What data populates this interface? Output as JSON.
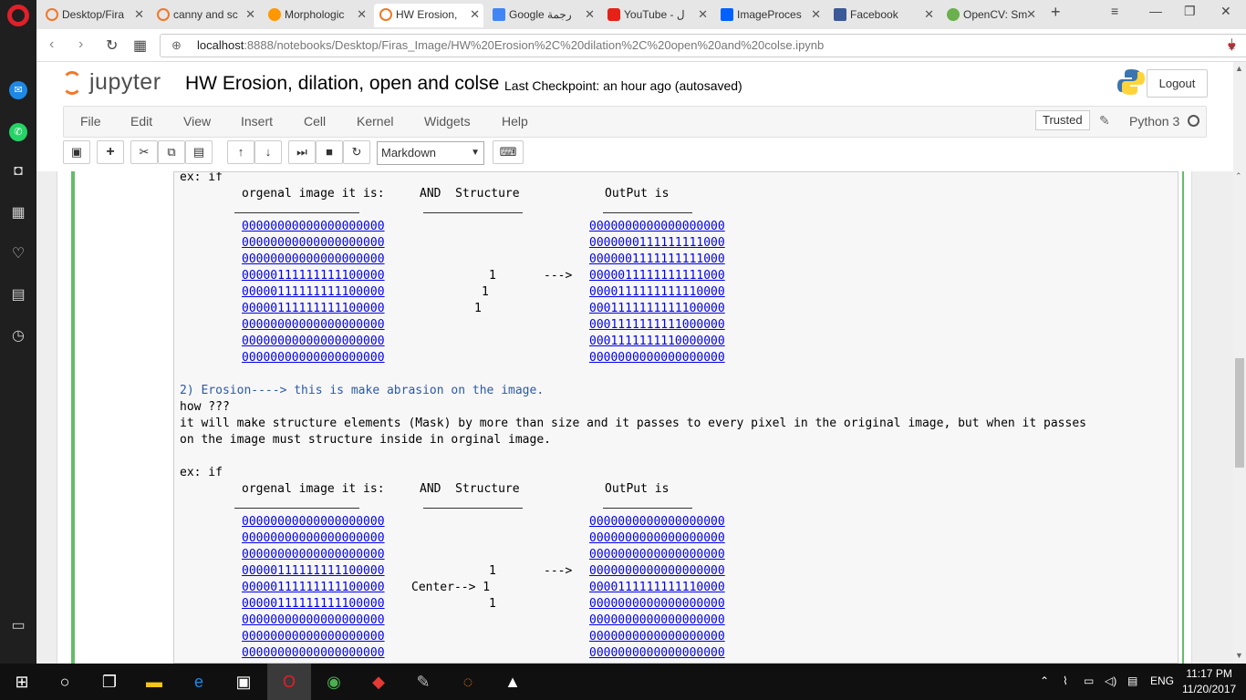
{
  "browser": {
    "tabs": [
      {
        "title": "Desktop/Fira",
        "favicon_color": "#f37726"
      },
      {
        "title": "canny and sc",
        "favicon_color": "#f37726"
      },
      {
        "title": "Morphologic",
        "favicon_color": "#ff9800"
      },
      {
        "title": "HW Erosion,",
        "favicon_color": "#f37726",
        "active": true
      },
      {
        "title": "Google رجمة",
        "favicon_color": "#4285f4"
      },
      {
        "title": "YouTube - ل",
        "favicon_color": "#e62117"
      },
      {
        "title": "ImageProces",
        "favicon_color": "#0061fe"
      },
      {
        "title": "Facebook",
        "favicon_color": "#3b5998"
      },
      {
        "title": "OpenCV: Sm",
        "favicon_color": "#6ab04c"
      }
    ],
    "url_host": "localhost",
    "url_rest": ":8888/notebooks/Desktop/Firas_Image/HW%20Erosion%2C%20dilation%2C%20open%20and%20colse.ipynb"
  },
  "jupyter": {
    "logo_text": "jupyter",
    "notebook_title": "HW Erosion, dilation, open and colse",
    "checkpoint": "Last Checkpoint: an hour ago (autosaved)",
    "logout_label": "Logout",
    "menu": [
      "File",
      "Edit",
      "View",
      "Insert",
      "Cell",
      "Kernel",
      "Widgets",
      "Help"
    ],
    "trusted_label": "Trusted",
    "kernel_name": "Python 3",
    "cell_type": "Markdown"
  },
  "cell": {
    "block1_prefix": "ex: if",
    "block1_header_orig": "orgenal image it is:",
    "block1_header_and": "AND  Structure",
    "block1_header_out": "OutPut is",
    "block1_orig_rows": [
      "00000000000000000000",
      "00000000000000000000",
      "00000000000000000000",
      "00000111111111100000",
      "00000111111111100000",
      "00000111111111100000",
      "00000000000000000000",
      "00000000000000000000",
      "00000000000000000000"
    ],
    "block1_struct_rows": [
      "1",
      "1",
      "1"
    ],
    "block1_arrow": "--->",
    "block1_out_rows": [
      "0000000000000000000",
      "0000000111111111000",
      "0000001111111111000",
      "0000011111111111000",
      "0000111111111110000",
      "0001111111111100000",
      "0001111111111000000",
      "0001111111110000000",
      "0000000000000000000"
    ],
    "erosion_title": "2) Erosion----> this is make abrasion on the image.",
    "how": "how ???",
    "explain_line1": "it will make structure elements (Mask) by more than size and it passes to every pixel in the original image, but when it passes",
    "explain_line2": "on the image must structure inside in orginal image.",
    "block2_prefix": "ex: if",
    "block2_header_orig": "orgenal image it is:",
    "block2_header_and": "AND  Structure",
    "block2_header_out": "OutPut is",
    "block2_orig_rows": [
      "00000000000000000000",
      "00000000000000000000",
      "00000000000000000000",
      "00000111111111100000",
      "00000111111111100000",
      "00000111111111100000",
      "00000000000000000000",
      "00000000000000000000",
      "00000000000000000000"
    ],
    "block2_struct_rows": [
      "1",
      "Center--> 1",
      "1"
    ],
    "block2_arrow": "--->",
    "block2_out_rows": [
      "0000000000000000000",
      "0000000000000000000",
      "0000000000000000000",
      "0000000000000000000",
      "0000111111111110000",
      "0000000000000000000",
      "0000000000000000000",
      "0000000000000000000",
      "0000000000000000000"
    ]
  },
  "taskbar": {
    "language": "ENG",
    "time": "11:17 PM",
    "date": "11/20/2017"
  }
}
